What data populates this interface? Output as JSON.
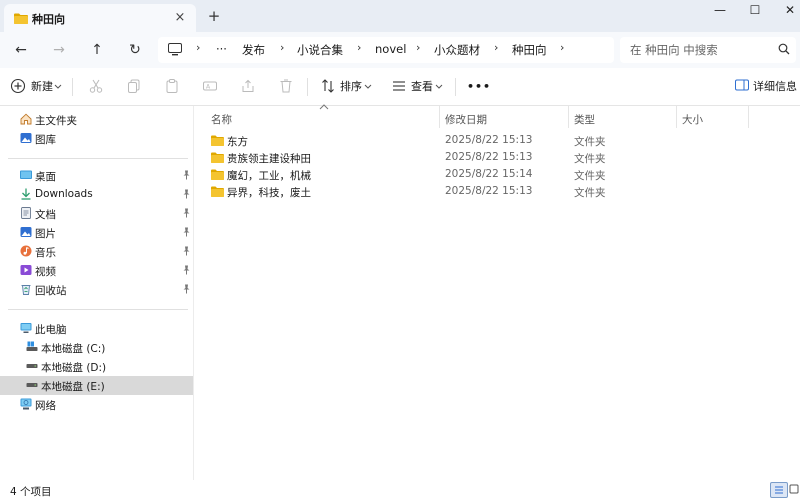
{
  "window": {
    "tab_title": "种田向",
    "tab_close": "×",
    "new_tab": "+",
    "minimize": "—",
    "maximize": "☐",
    "close": "✕"
  },
  "nav": {
    "back": "←",
    "forward": "→",
    "up": "↑",
    "refresh": "↻",
    "more": "···"
  },
  "breadcrumb": [
    "发布",
    "小说合集",
    "novel",
    "小众题材",
    "种田向"
  ],
  "breadcrumb_sep": "›",
  "search": {
    "placeholder": "在 种田向 中搜索"
  },
  "toolbar": {
    "new_label": "新建",
    "sort_label": "排序",
    "view_label": "查看",
    "more_label": "•••",
    "details_label": "详细信息"
  },
  "sidebar": {
    "quick": [
      {
        "label": "主文件夹",
        "icon": "home-icon"
      },
      {
        "label": "图库",
        "icon": "gallery-icon"
      }
    ],
    "pinned": [
      {
        "label": "桌面",
        "icon": "desktop-icon"
      },
      {
        "label": "Downloads",
        "icon": "download-icon"
      },
      {
        "label": "文档",
        "icon": "document-icon"
      },
      {
        "label": "图片",
        "icon": "pictures-icon"
      },
      {
        "label": "音乐",
        "icon": "music-icon"
      },
      {
        "label": "视频",
        "icon": "video-icon"
      },
      {
        "label": "回收站",
        "icon": "recycle-bin-icon"
      }
    ],
    "this_pc": "此电脑",
    "drives": [
      {
        "label": "本地磁盘 (C:)",
        "selected": false
      },
      {
        "label": "本地磁盘 (D:)",
        "selected": false
      },
      {
        "label": "本地磁盘 (E:)",
        "selected": true
      }
    ],
    "network": "网络"
  },
  "columns": {
    "name": "名称",
    "modified": "修改日期",
    "type": "类型",
    "size": "大小"
  },
  "files": [
    {
      "name": "东方",
      "modified": "2025/8/22 15:13",
      "type": "文件夹",
      "size": ""
    },
    {
      "name": "贵族领主建设种田",
      "modified": "2025/8/22 15:13",
      "type": "文件夹",
      "size": ""
    },
    {
      "name": "魔幻，工业，机械",
      "modified": "2025/8/22 15:14",
      "type": "文件夹",
      "size": ""
    },
    {
      "name": "异界，科技，废土",
      "modified": "2025/8/22 15:13",
      "type": "文件夹",
      "size": ""
    }
  ],
  "status": {
    "item_count": "4 个项目"
  },
  "colors": {
    "folder": "#f4c430",
    "folder_dark": "#e0a800",
    "accent": "#2f6fd1",
    "selected_row": "#d9d9d9"
  }
}
